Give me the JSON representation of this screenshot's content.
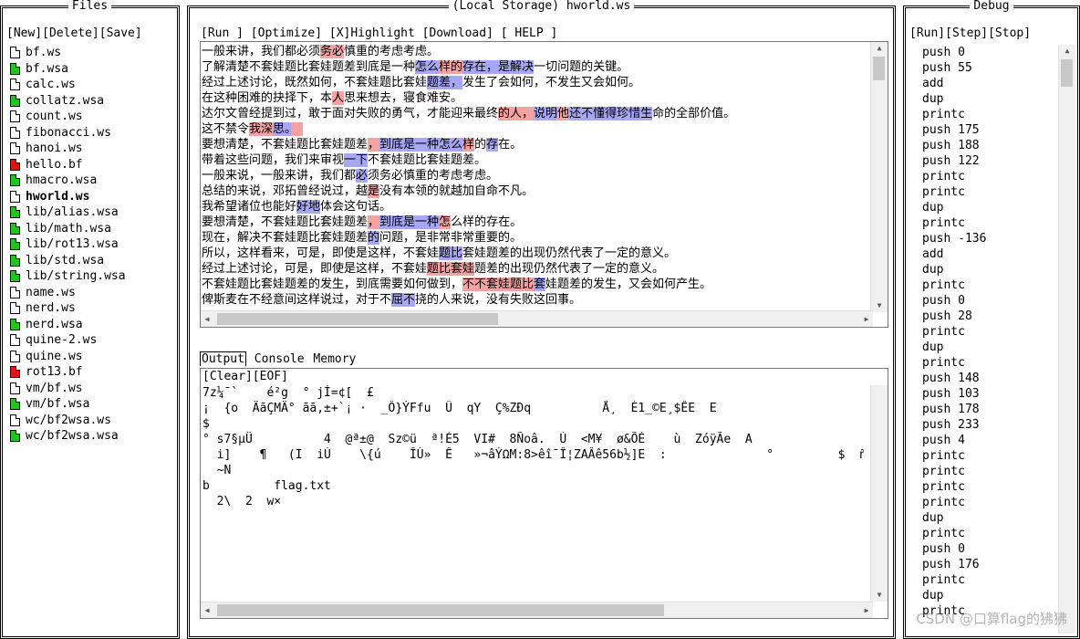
{
  "files": {
    "title": "Files",
    "toolbar": "[New][Delete][Save]",
    "items": [
      {
        "name": "bf.ws",
        "icon": "blank"
      },
      {
        "name": "bf.wsa",
        "icon": "green"
      },
      {
        "name": "calc.ws",
        "icon": "blank"
      },
      {
        "name": "collatz.wsa",
        "icon": "green"
      },
      {
        "name": "count.ws",
        "icon": "blank"
      },
      {
        "name": "fibonacci.ws",
        "icon": "blank"
      },
      {
        "name": "hanoi.ws",
        "icon": "blank"
      },
      {
        "name": "hello.bf",
        "icon": "red"
      },
      {
        "name": "hmacro.wsa",
        "icon": "green"
      },
      {
        "name": "hworld.ws",
        "icon": "blank",
        "active": true
      },
      {
        "name": "lib/alias.wsa",
        "icon": "green"
      },
      {
        "name": "lib/math.wsa",
        "icon": "green"
      },
      {
        "name": "lib/rot13.wsa",
        "icon": "green"
      },
      {
        "name": "lib/std.wsa",
        "icon": "green"
      },
      {
        "name": "lib/string.wsa",
        "icon": "green"
      },
      {
        "name": "name.ws",
        "icon": "blank"
      },
      {
        "name": "nerd.ws",
        "icon": "blank"
      },
      {
        "name": "nerd.wsa",
        "icon": "green"
      },
      {
        "name": "quine-2.ws",
        "icon": "blank"
      },
      {
        "name": "quine.ws",
        "icon": "blank"
      },
      {
        "name": "rot13.bf",
        "icon": "red"
      },
      {
        "name": "vm/bf.ws",
        "icon": "blank"
      },
      {
        "name": "vm/bf.wsa",
        "icon": "green"
      },
      {
        "name": "wc/bf2wsa.ws",
        "icon": "blank"
      },
      {
        "name": "wc/bf2wsa.wsa",
        "icon": "green"
      }
    ]
  },
  "editor": {
    "title": "(Local Storage) hworld.ws",
    "toolbar": "[Run ] [Optimize] [X]Highlight [Download] [ HELP ]",
    "code_lines": [
      [
        [
          "",
          "一般来讲，我们都必须"
        ],
        [
          "r",
          "务必"
        ],
        [
          "",
          "慎重的考虑考虑。"
        ]
      ],
      [
        [
          "",
          "了解清楚不套娃题比套娃题差到底是一种"
        ],
        [
          "b",
          "怎么"
        ],
        [
          "r",
          "样的"
        ],
        [
          "b",
          "存在，是解决"
        ],
        [
          "",
          "一切问题的关键。"
        ]
      ],
      [
        [
          "",
          "经过上述讨论，既然如何，不套娃题比套娃"
        ],
        [
          "b",
          "题差，"
        ],
        [
          "",
          "发生了会如何，不发生又会如何。"
        ]
      ],
      [
        [
          "",
          "在这种困难的抉择下，本"
        ],
        [
          "r",
          "人"
        ],
        [
          "",
          "思来想去，寝食难安。"
        ]
      ],
      [
        [
          "",
          "达尔文曾经提到过，敢于面对失败的勇气，才能迎来最终"
        ],
        [
          "r",
          "的人，"
        ],
        [
          "b",
          "说明"
        ],
        [
          "r",
          "他"
        ],
        [
          "b",
          "还不懂得珍惜生"
        ],
        [
          "",
          "命的全部价值。"
        ]
      ],
      [
        [
          "",
          "这不禁令"
        ],
        [
          "r",
          "我深"
        ],
        [
          "b",
          "思。"
        ],
        [
          "r",
          "　"
        ]
      ],
      [
        [
          "",
          "要想清楚，不套娃题比套娃题差"
        ],
        [
          "r",
          "，"
        ],
        [
          "b",
          "到底是一种怎么"
        ],
        [
          "r",
          "样"
        ],
        [
          "",
          "的"
        ],
        [
          "b",
          "存"
        ],
        [
          "",
          "在。"
        ]
      ],
      [
        [
          "",
          "带着这些问题，我们来审视"
        ],
        [
          "b",
          "一下"
        ],
        [
          "",
          "不套娃题比套娃题差。"
        ]
      ],
      [
        [
          "",
          "一般来说，一般来讲，我们都"
        ],
        [
          "b",
          "必"
        ],
        [
          "",
          "须务必慎重的考虑考虑。"
        ]
      ],
      [
        [
          "",
          "总结的来说，邓拓曾经说过，越"
        ],
        [
          "r",
          "是"
        ],
        [
          "",
          "没有本领的就越加自命不凡。"
        ]
      ],
      [
        [
          "",
          "我希望诸位也能好"
        ],
        [
          "b",
          "好地"
        ],
        [
          "",
          "体会这句话。"
        ]
      ],
      [
        [
          "",
          "要想清楚，不套娃题比套娃题差"
        ],
        [
          "r",
          "，"
        ],
        [
          "b",
          "到底是一种"
        ],
        [
          "r",
          "怎"
        ],
        [
          "",
          "么样的存在。"
        ]
      ],
      [
        [
          "",
          "现在，解决不套娃题比套娃题差"
        ],
        [
          "b",
          "的"
        ],
        [
          "",
          "问题，是非常非常重要的。"
        ]
      ],
      [
        [
          "",
          "所以，这样看来，可是，即使是这样，不套娃"
        ],
        [
          "b",
          "题比"
        ],
        [
          "",
          "套娃题差的出现仍然代表了一定的意义。"
        ]
      ],
      [
        [
          "",
          "经过上述讨论，可是，即使是这样，不套娃"
        ],
        [
          "r",
          "题比套娃"
        ],
        [
          "",
          "题差的出现仍然代表了一定的意义。"
        ]
      ],
      [
        [
          "",
          "不套娃题比套娃题差的发生，到底需要如何做到，"
        ],
        [
          "r",
          "不不套娃题比"
        ],
        [
          "b",
          "套"
        ],
        [
          "",
          "娃题差的发生，又会如何产生。"
        ]
      ],
      [
        [
          "",
          "俾斯麦在不经意间这样说过，对于不"
        ],
        [
          "b",
          "屈不"
        ],
        [
          "",
          "挠的人来说，没有失败这回事。"
        ]
      ]
    ],
    "bottom_tabs": [
      "Output",
      "Console",
      "Memory"
    ],
    "output_toolbar": "[Clear][EOF]",
    "output_lines": [
      "7z¼¯`    é²g  ° jÍ=¢[  £",
      "¡  {o  ÄāÇMÄ° āā,±+`¡ ·  _Ô}ÝFfu  Û  qY  Ç%ZÐq          Å¸  È1_©E¸$ÊE  E",
      "$",
      "° s7§µÜ          4  @ª±@  Sz©ü  ª!É5  VI#  8Ñoâ.  Ú  <M¥  ø&ÕÉ    ù  ZóÿÃe  A",
      "  i]    ¶   (I  iÚ    \\{ú    ÎÙ»  Ê   »¬âÝΩM:8>êî¯Î¦ZAÂê56b½]E  :              °         $  ñ",
      "  ~N",
      "b         flag.txt",
      "  2\\  2  w×"
    ]
  },
  "debug": {
    "title": "Debug",
    "toolbar": "[Run][Step][Stop]",
    "lines": [
      "push 0",
      "push 55",
      "add",
      "dup",
      "printc",
      "push 175",
      "push 188",
      "push 122",
      "printc",
      "printc",
      "dup",
      "printc",
      "push -136",
      "add",
      "dup",
      "printc",
      "push 0",
      "push 28",
      "printc",
      "dup",
      "printc",
      "push 148",
      "push 103",
      "push 178",
      "push 233",
      "push 4",
      "printc",
      "printc",
      "printc",
      "printc",
      "dup",
      "printc",
      "push 0",
      "push 176",
      "printc",
      "dup",
      "printc"
    ]
  },
  "watermark": "CSDN @口算flag的狒狒"
}
